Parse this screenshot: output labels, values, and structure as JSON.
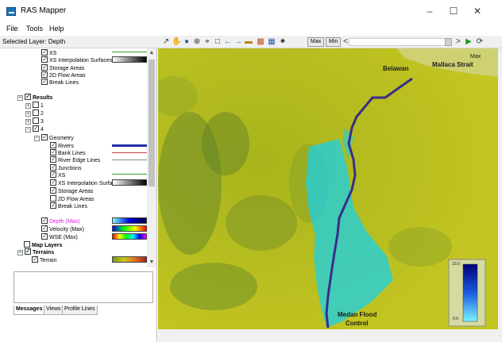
{
  "window": {
    "title": "RAS Mapper",
    "controls": {
      "minimize": "–",
      "maximize": "☐",
      "close": "✕"
    }
  },
  "menu": [
    "File",
    "Tools",
    "Help"
  ],
  "toolbar": {
    "selected_layer": "Selected Layer: Depth",
    "max_label": "Max",
    "min_label": "Min",
    "nav_left": "<",
    "nav_right": ">"
  },
  "tree": {
    "rows": [
      {
        "label": "XS"
      },
      {
        "label": "XS Interpolation Surfaces"
      },
      {
        "label": "Storage Areas"
      },
      {
        "label": "2D Flow Areas"
      },
      {
        "label": "Break Lines"
      },
      {
        "label": "Results"
      },
      {
        "label": "1"
      },
      {
        "label": "2"
      },
      {
        "label": "3"
      },
      {
        "label": "4"
      },
      {
        "label": "Geometry"
      },
      {
        "label": "Rivers"
      },
      {
        "label": "Bank Lines"
      },
      {
        "label": "River Edge Lines"
      },
      {
        "label": "Junctions"
      },
      {
        "label": "XS"
      },
      {
        "label": "XS Interpolation Surfa"
      },
      {
        "label": "Storage Areas"
      },
      {
        "label": "2D Flow Areas"
      },
      {
        "label": "Break Lines"
      },
      {
        "label": "Depth (Max)"
      },
      {
        "label": "Velocity (Max)"
      },
      {
        "label": "WSE (Max)"
      },
      {
        "label": "Map Layers"
      },
      {
        "label": "Terrains"
      },
      {
        "label": "Terrain"
      }
    ]
  },
  "tabs": [
    "Messages",
    "Views",
    "Profile Lines"
  ],
  "map": {
    "labels": {
      "belawan": "Belawan",
      "malacca": "Mallaca Strait",
      "medan_1": "Medan Flood",
      "medan_2": "Control",
      "max": "Max"
    },
    "legend": {
      "top": "10.0",
      "bottom": "0.0"
    }
  },
  "colors": {
    "depth_label": "#e020e0",
    "river": "#3a2c8a",
    "flood": "#19d0e8",
    "terrain": "#b9bf1f"
  }
}
